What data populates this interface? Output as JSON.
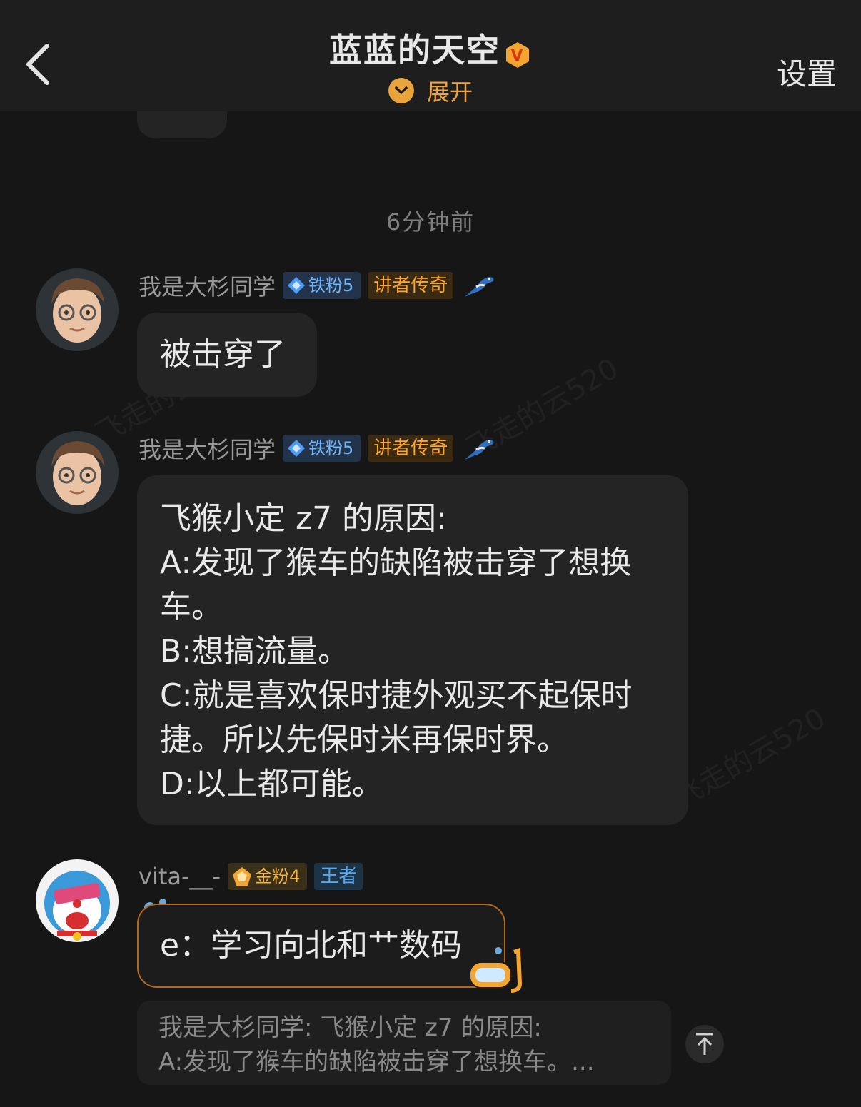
{
  "header": {
    "title": "蓝蓝的天空",
    "expand_label": "展开",
    "settings_label": "设置",
    "vip_badge_letter": "V"
  },
  "timestamp": "6分钟前",
  "messages": [
    {
      "user": "我是大杉同学",
      "fan_badge": "铁粉5",
      "title_badge": "讲者传奇",
      "lines": [
        "被击穿了"
      ]
    },
    {
      "user": "我是大杉同学",
      "fan_badge": "铁粉5",
      "title_badge": "讲者传奇",
      "lines": [
        "飞猴小定 z7 的原因:",
        "A:发现了猴车的缺陷被击穿了想换",
        "车。",
        "B:想搞流量。",
        "C:就是喜欢保时捷外观买不起保时",
        "捷。所以先保时米再保时界。",
        "D:以上都可能。"
      ]
    },
    {
      "user": "vita-__-",
      "fan_badge": "金粉4",
      "title_badge": "王者",
      "lines": [
        "e：学习向北和艹数码"
      ],
      "quote": {
        "line1": "我是大杉同学: 飞猴小定 z7 的原因:",
        "line2": "A:发现了猴车的缺陷被击穿了想换车。..."
      }
    }
  ],
  "watermark_text": "飞走的云520",
  "colors": {
    "background": "#161616",
    "header_bg": "#1e1e1e",
    "bubble_bg": "#242424",
    "accent_orange": "#f0a53a",
    "fan_blue": "#6fb6ff"
  }
}
